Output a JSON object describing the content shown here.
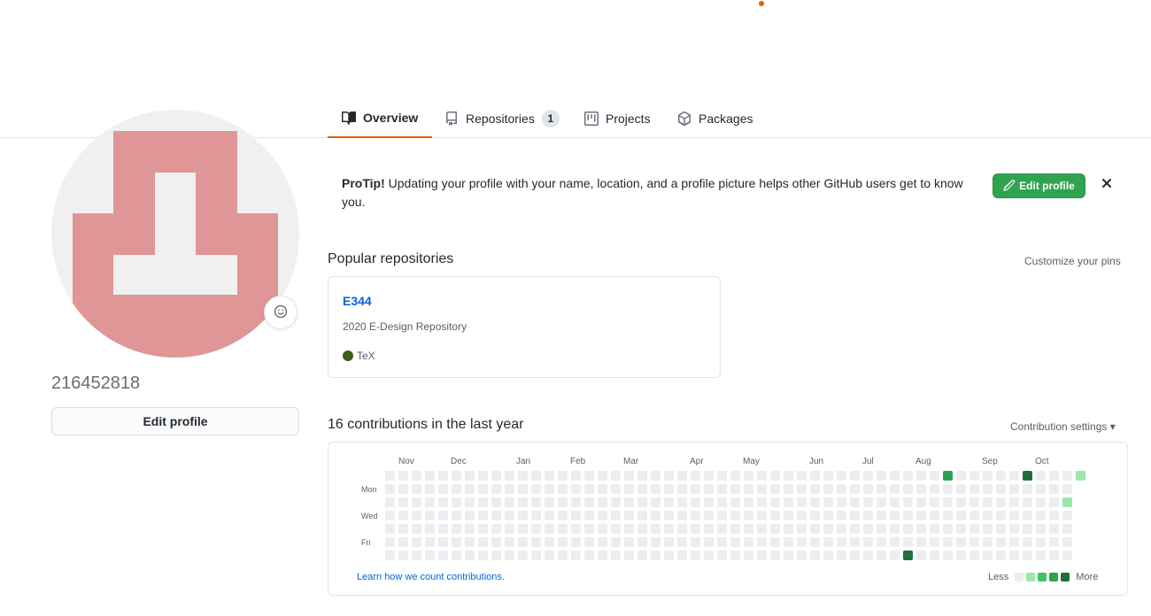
{
  "tabs": [
    {
      "label": "Overview",
      "icon": "book-icon",
      "selected": true
    },
    {
      "label": "Repositories",
      "icon": "repo-icon",
      "counter": "1"
    },
    {
      "label": "Projects",
      "icon": "project-icon"
    },
    {
      "label": "Packages",
      "icon": "package-icon"
    }
  ],
  "profile": {
    "username": "216452818",
    "edit_label": "Edit profile",
    "avatar_color": "#e09596"
  },
  "protip": {
    "bold": "ProTip!",
    "text": " Updating your profile with your name, location, and a profile picture helps other GitHub users get to know you.",
    "button_label": "Edit profile",
    "close_icon": "x-icon"
  },
  "popular": {
    "title": "Popular repositories",
    "customize_label": "Customize your pins",
    "repos": [
      {
        "name": "E344",
        "description": "2020 E-Design Repository",
        "language": "TeX",
        "language_color": "#3d6117"
      }
    ]
  },
  "contributions": {
    "title": "16 contributions in the last year",
    "settings_label": "Contribution settings ▾",
    "months": [
      "Nov",
      "Dec",
      "Jan",
      "Feb",
      "Mar",
      "Apr",
      "May",
      "Jun",
      "Jul",
      "Aug",
      "Sep",
      "Oct"
    ],
    "weekdays": [
      "Mon",
      "Wed",
      "Fri"
    ],
    "learn_label": "Learn how we count contributions.",
    "less_label": "Less",
    "more_label": "More",
    "level_colors": [
      "#ebedf0",
      "#9be9a8",
      "#40c463",
      "#30a14e",
      "#216e39"
    ],
    "weeks": 53,
    "active_cells": [
      {
        "week": 42,
        "day": 0,
        "level": 3
      },
      {
        "week": 48,
        "day": 0,
        "level": 4
      },
      {
        "week": 52,
        "day": 0,
        "level": 1
      },
      {
        "week": 51,
        "day": 2,
        "level": 1
      },
      {
        "week": 39,
        "day": 6,
        "level": 4
      }
    ]
  }
}
